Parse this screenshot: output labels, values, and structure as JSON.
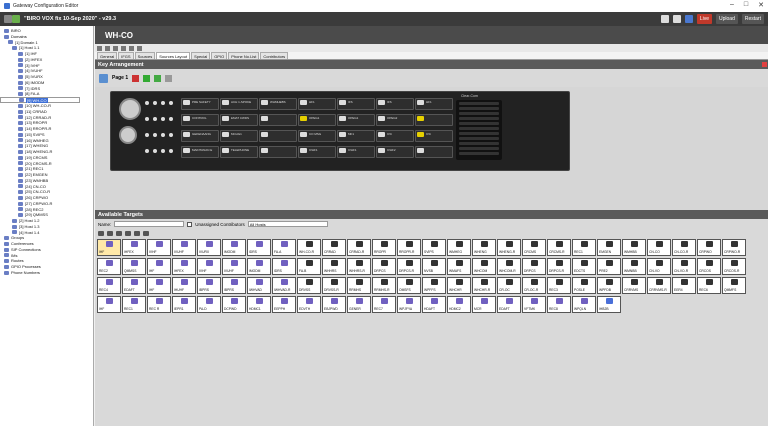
{
  "window": {
    "title": "Gateway Configuration Editor",
    "controls": [
      "–",
      "□",
      "✕"
    ]
  },
  "toolbar": {
    "title": "\"BIRO VOX fix 10-Sep 2020\" - v29.3",
    "live": "Live",
    "upload": "Upload",
    "restart": "Restart"
  },
  "tree": [
    "BIRO",
    "Domains",
    "[1] Domain 1",
    "[1] Host 1.1",
    "[1] IHF",
    "[2] IHFEX",
    "[3] IVHF",
    "[4] IVUHF",
    "[5] IVURX",
    "[6] IMODM",
    "[7] IDRS",
    "[8] FA-A",
    "[9] WH-CO",
    "[10] WH-CO-R",
    "[11] CRRAD",
    "[12] CRRAD-R",
    "[13] RROPR",
    "[14] RROPR-R",
    "[15] SVIPS",
    "[16] WMHEG",
    "[17] WHENG",
    "[18] WHENG-R",
    "[19] CRCMS",
    "[20] CRCMS-R",
    "[21] REC1",
    "[22] EMGEN",
    "[23] WMHBB",
    "[24] CN-CO",
    "[25] CN-CO-R",
    "[26] CRPWO",
    "[27] CRPWO-R",
    "[28] REC2",
    "[29] QMMSS",
    "[2] Host 1.2",
    "[3] Host 1.3",
    "[4] Host 1.4",
    "Groups",
    "Conferences",
    "SIP Connections",
    "IMs",
    "Routes",
    "GPIO Processes",
    "Phone Numbers"
  ],
  "main": {
    "header": "WH-CO",
    "section_key": "Key Arrangement",
    "page_label": "Page 1",
    "section_targets": "Available Targets",
    "name_label": "Name:",
    "unassigned": "Unassigned Contributors",
    "hosts_select": "All Hosts"
  },
  "tabs": [
    "General",
    "IFGS",
    "Sources",
    "Sources Layout",
    "Special",
    "GPIO",
    "Phone No.List",
    "Contributors"
  ],
  "keys": [
    [
      "PRE SAFETY",
      "ACH 1-SPOKE",
      "WHMHEBS",
      "HF1",
      "IFS",
      "IFS",
      "HF1"
    ],
    [
      "CONTROL",
      "EMAT CWDS",
      "",
      "OPEG1",
      "OPEG1",
      "OPEG2",
      ""
    ],
    [
      "GEKENAANG",
      "MCHG1",
      "",
      "CO MSG",
      "MF1",
      "IVC",
      "IVC"
    ],
    [
      "MAINTANAN E",
      "TELEPHONE",
      "",
      "IVHF1",
      "IVHF1",
      "IVHF2",
      ""
    ]
  ],
  "speaker": {
    "brand": "Clear-Com",
    "label": "VOL / L"
  },
  "targets": [
    [
      "IHF",
      "IHFEX",
      "IVHF",
      "IVUHF",
      "IVURX",
      "IMODM",
      "IDRS",
      "FA-A",
      "WH-CO-R",
      "CRRAD",
      "CRRAD-R",
      "RROPR",
      "RROPR-R",
      "SVIPS",
      "WMHEG",
      "WHENG",
      "WHENG-R",
      "CRCMS",
      "CRCMS-R",
      "REC1",
      "EMGEN",
      "WMHBB",
      "CN-CO",
      "CN-CO-R",
      "CRPWO",
      "CRPWO-R"
    ],
    [
      "REC2",
      "QMMSS",
      "IHF",
      "IHFEX",
      "IVHF",
      "IVUHF",
      "IMODM",
      "IDRS",
      "FA-B",
      "WHHRS",
      "WHHRS-R",
      "DRPCS",
      "DRPCS-R",
      "NVSB",
      "WMAFS",
      "WHCOM",
      "WHCOM-R",
      "DRPCS",
      "DRPCS-R",
      "EDCTS",
      "PRE2",
      "WMNBB",
      "CN-VO",
      "CN-VO-R",
      "CRCOS",
      "CRCOS-R"
    ],
    [
      "REC4",
      "EDAFT",
      "IHF",
      "IHUHF",
      "IBPRS",
      "IBPRS",
      "IWHVAD",
      "IWHVAD-R",
      "DRVSS",
      "DRVSS-R",
      "RRMHS",
      "RRMHS-R",
      "OMSFS",
      "WPFFS",
      "WHCHR",
      "WHCHR-R",
      "CR-OC",
      "CR-OC-R",
      "REC3",
      "POSLE",
      "WPFDB",
      "CRRVMS",
      "CRRVMS-R",
      "EER4",
      "REC6",
      "QMMFS"
    ],
    [
      "IHF",
      "REC1",
      "REC R",
      "IEPR1",
      "PA-D",
      "DCPWD",
      "HDMC1",
      "EEPPH",
      "EDVTH",
      "EBJPWD",
      "GENER",
      "REC7",
      "WPJFYA",
      "HDAFT",
      "HDMC2",
      "MCR",
      "EDAFT",
      "VFTMK",
      "REC8",
      "WPQLN",
      "IHB2B"
    ]
  ]
}
